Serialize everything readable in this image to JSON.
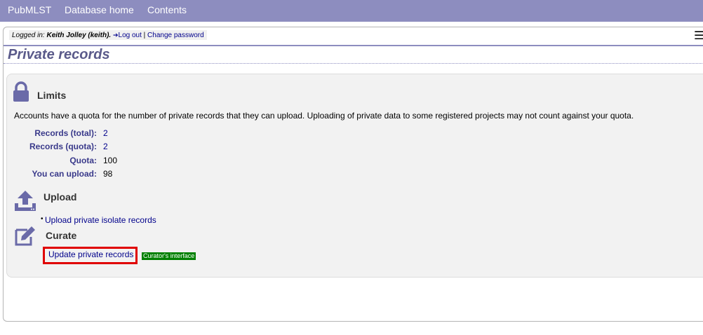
{
  "nav": {
    "items": [
      {
        "label": "PubMLST"
      },
      {
        "label": "Database home"
      },
      {
        "label": "Contents"
      }
    ]
  },
  "login": {
    "prefix": "Logged in: ",
    "user": "Keith Jolley (keith).",
    "logout": "Log out",
    "separator": " | ",
    "change_password": "Change password"
  },
  "page": {
    "title": "Private records"
  },
  "limits": {
    "heading": "Limits",
    "description": "Accounts have a quota for the number of private records that they can upload. Uploading of private data to some registered projects may not count against your quota.",
    "rows": [
      {
        "label": "Records (total):",
        "value": "2"
      },
      {
        "label": "Records (quota):",
        "value": "2"
      },
      {
        "label": "Quota:",
        "value": "100"
      },
      {
        "label": "You can upload:",
        "value": "98"
      }
    ]
  },
  "upload": {
    "heading": "Upload",
    "link": "Upload private isolate records"
  },
  "curate": {
    "heading": "Curate",
    "link": "Update private records",
    "badge": "Curator's interface"
  },
  "colors": {
    "nav_bg": "#8d8dbf",
    "highlight": "#e00000",
    "badge_bg": "#008000",
    "link": "#00008b"
  },
  "icons": {
    "limits": "lock-icon",
    "upload": "upload-icon",
    "curate": "edit-icon",
    "menu": "hamburger-menu-icon",
    "logout": "logout-icon"
  }
}
